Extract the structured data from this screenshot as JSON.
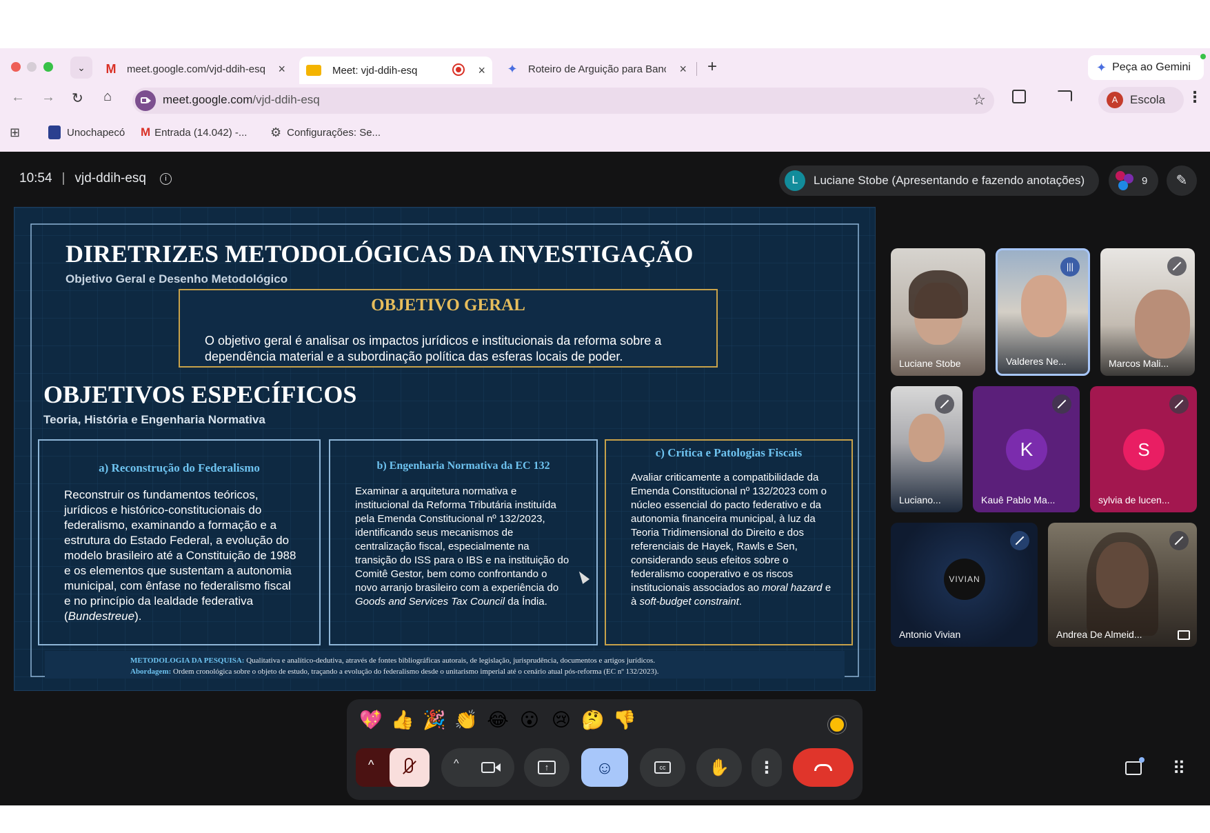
{
  "browser": {
    "tabs": [
      {
        "title": "meet.google.com/vjd-ddih-esq",
        "active": false
      },
      {
        "title": "Meet: vjd-ddih-esq",
        "active": true
      },
      {
        "title": "Roteiro de Arguição para Banca",
        "active": false
      }
    ],
    "gemini_label": "Peça ao Gemini",
    "url_host": "meet.google.com",
    "url_path": "/vjd-ddih-esq",
    "profile_initial": "A",
    "profile_label": "Escola",
    "bookmarks": [
      "Unochapecó",
      "Entrada (14.042) -...",
      "Configurações: Se..."
    ]
  },
  "meet": {
    "time": "10:54",
    "separator": "|",
    "meeting_code": "vjd-ddih-esq",
    "presenter_initial": "L",
    "presenter_label": "Luciane Stobe (Apresentando e fazendo anotações)",
    "participant_count": "9"
  },
  "slide": {
    "title": "DIRETRIZES METODOLÓGICAS DA INVESTIGAÇÃO",
    "subtitle": "Objetivo Geral e Desenho Metodológico",
    "general_objective_heading": "OBJETIVO GERAL",
    "general_objective_text": "O objetivo geral é analisar os impactos jurídicos e institucionais da reforma sobre a dependência material e a subordinação política das esferas locais de poder.",
    "specific_heading": "OBJETIVOS ESPECÍFICOS",
    "specific_subheading": "Teoria, História e Engenharia Normativa",
    "box_a_title": "a) Reconstrução do Federalismo",
    "box_a_text": "Reconstruir os fundamentos teóricos, jurídicos e histórico-constitucionais do federalismo, examinando a formação e a estrutura do Estado Federal, a evolução do modelo brasileiro até a Constituição de 1988 e os elementos que sustentam a autonomia municipal, com ênfase no federalismo fiscal e no princípio da lealdade federativa (",
    "box_a_italic": "Bundestreue",
    "box_a_end": ").",
    "box_b_title": "b) Engenharia Normativa da EC 132",
    "box_b_text": "Examinar a arquitetura normativa e institucional da Reforma Tributária instituída pela Emenda Constitucional nº 132/2023, identificando seus mecanismos de centralização fiscal, especialmente na transição do ISS para o IBS e na instituição do Comitê Gestor, bem como confrontando o novo arranjo brasileiro com a experiência do ",
    "box_b_italic": "Goods and Services Tax Council",
    "box_b_end": " da Índia.",
    "box_c_title": "c) Crítica e Patologias Fiscais",
    "box_c_text": "Avaliar criticamente a compatibilidade da Emenda Constitucional nº 132/2023 com o núcleo essencial do pacto federativo e da autonomia financeira municipal, à luz da Teoria Tridimensional do Direito e dos referenciais de Hayek, Rawls e Sen, considerando seus efeitos sobre o federalismo cooperativo e os riscos institucionais associados ao ",
    "box_c_italic1": "moral hazard",
    "box_c_mid": " e à ",
    "box_c_italic2": "soft-budget constraint",
    "box_c_end": ".",
    "method_label": "METODOLOGIA DA PESQUISA:",
    "method_text": "Qualitativa e analítico-dedutiva, através de fontes bibliográficas autorais, de legislação, jurisprudência, documentos e artigos jurídicos.",
    "approach_label": "Abordagem:",
    "approach_text": "Ordem cronológica sobre o objeto de estudo, traçando a evolução do federalismo desde o unitarismo imperial até o cenário atual pós-reforma (EC nº 132/2023)."
  },
  "participants": [
    {
      "name": "Luciane Stobe",
      "muted": false
    },
    {
      "name": "Valderes Ne...",
      "muted": false,
      "speaking": true
    },
    {
      "name": "Marcos Mali...",
      "muted": true
    },
    {
      "name": "Luciano...",
      "muted": true
    },
    {
      "name": "Kauê Pablo Ma...",
      "initial": "K",
      "muted": true,
      "color": "#7b2cad"
    },
    {
      "name": "sylvia de lucen...",
      "initial": "S",
      "muted": true,
      "color": "#c2185b"
    },
    {
      "name": "Antonio Vivian",
      "muted": true
    },
    {
      "name": "Andrea De Almeid...",
      "muted": true
    }
  ],
  "reactions": [
    "💖",
    "👍",
    "🎉",
    "👏",
    "😂",
    "😮",
    "😢",
    "🤔",
    "👎"
  ],
  "colors": {
    "end_call": "#e0352b",
    "reactions_active": "#a8c7fa",
    "mic_muted_bg": "#f9dedc"
  }
}
